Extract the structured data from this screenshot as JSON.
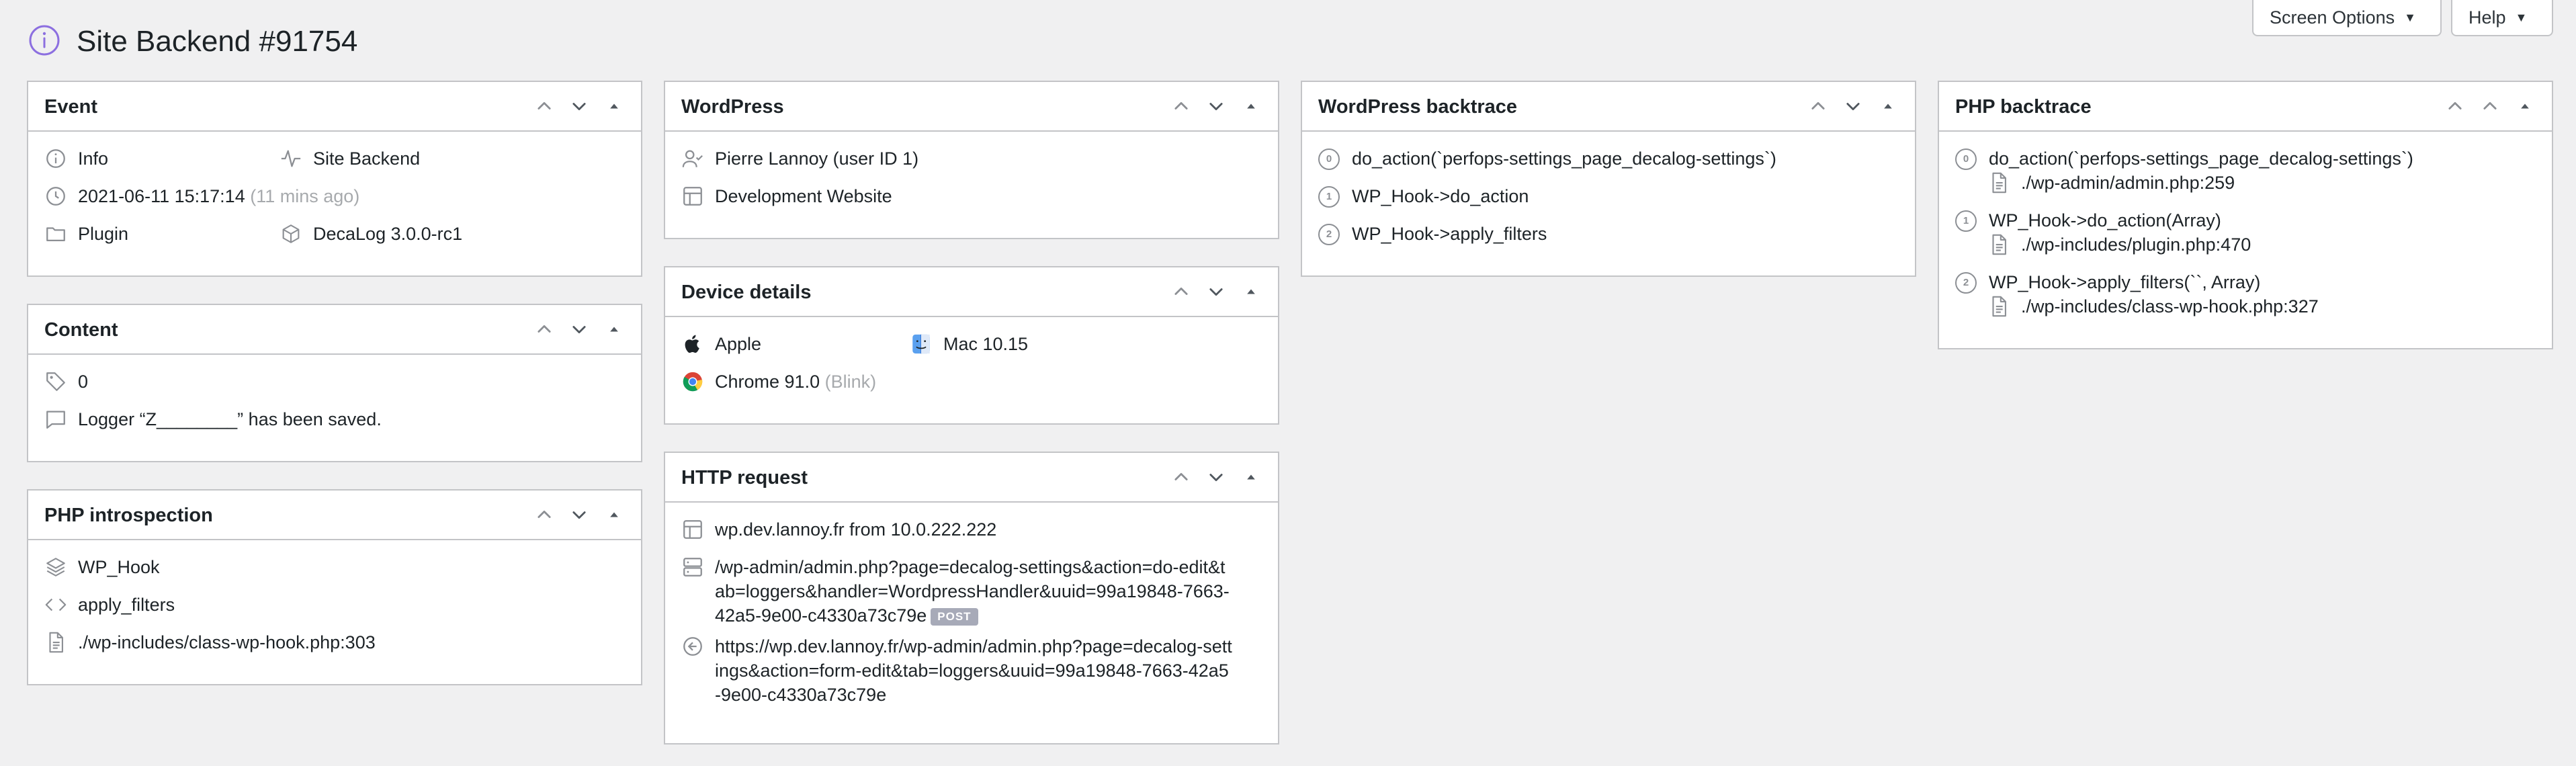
{
  "header": {
    "title": "Site Backend #91754",
    "screen_options": "Screen Options",
    "help": "Help"
  },
  "colors": {
    "accent": "#8c6fe0",
    "icon": "#8c8f94",
    "border": "#c3c4c7",
    "background": "#f0f0f1"
  },
  "event": {
    "title": "Event",
    "level": "Info",
    "channel": "Site Backend",
    "datetime": "2021-06-11 15:17:14",
    "ago": "(11 mins ago)",
    "source_type": "Plugin",
    "source_name": "DecaLog 3.0.0-rc1"
  },
  "content": {
    "title": "Content",
    "code": "0",
    "message": "Logger “Z________” has been saved."
  },
  "php_introspection": {
    "title": "PHP introspection",
    "class": "WP_Hook",
    "function": "apply_filters",
    "file": "./wp-includes/class-wp-hook.php:303"
  },
  "wordpress": {
    "title": "WordPress",
    "user": "Pierre Lannoy (user ID 1)",
    "site": "Development Website"
  },
  "device": {
    "title": "Device details",
    "brand": "Apple",
    "os": "Mac 10.15",
    "browser": "Chrome 91.0",
    "engine": "(Blink)"
  },
  "http": {
    "title": "HTTP request",
    "host": "wp.dev.lannoy.fr from 10.0.222.222",
    "path": "/wp-admin/admin.php?page=decalog-settings&action=do-edit&tab=loggers&handler=WordpressHandler&uuid=99a19848-7663-42a5-9e00-c4330a73c79e",
    "verb": "POST",
    "referrer": "https://wp.dev.lannoy.fr/wp-admin/admin.php?page=decalog-settings&action=form-edit&tab=loggers&uuid=99a19848-7663-42a5-9e00-c4330a73c79e"
  },
  "wp_backtrace": {
    "title": "WordPress backtrace",
    "items": [
      {
        "index": "0",
        "call": "do_action(`perfops-settings_page_decalog-settings`)"
      },
      {
        "index": "1",
        "call": "WP_Hook->do_action"
      },
      {
        "index": "2",
        "call": "WP_Hook->apply_filters"
      }
    ]
  },
  "php_backtrace": {
    "title": "PHP backtrace",
    "items": [
      {
        "index": "0",
        "call": "do_action(`perfops-settings_page_decalog-settings`)",
        "file": "./wp-admin/admin.php:259"
      },
      {
        "index": "1",
        "call": "WP_Hook->do_action(Array)",
        "file": "./wp-includes/plugin.php:470"
      },
      {
        "index": "2",
        "call": "WP_Hook->apply_filters(``, Array)",
        "file": "./wp-includes/class-wp-hook.php:327"
      }
    ]
  }
}
